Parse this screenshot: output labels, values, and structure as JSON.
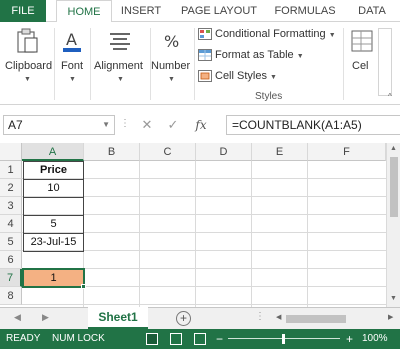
{
  "ribbon_tabs": [
    "FILE",
    "HOME",
    "INSERT",
    "PAGE LAYOUT",
    "FORMULAS",
    "DATA"
  ],
  "groups": {
    "clipboard": "Clipboard",
    "font": "Font",
    "alignment": "Alignment",
    "number": "Number",
    "conditional_formatting": "Conditional Formatting",
    "format_as_table": "Format as Table",
    "cell_styles": "Cell Styles",
    "styles_title": "Styles",
    "cells_partial": "Cel"
  },
  "formula_bar": {
    "name_box": "A7",
    "fx": "fx",
    "formula": "=COUNTBLANK(A1:A5)"
  },
  "columns": [
    "A",
    "B",
    "C",
    "D",
    "E",
    "F"
  ],
  "rows": [
    "1",
    "2",
    "3",
    "4",
    "5",
    "6",
    "7",
    "8"
  ],
  "cells": {
    "A1": "Price",
    "A2": "10",
    "A3": "",
    "A4": "5",
    "A5": "23-Jul-15",
    "A7": "1"
  },
  "sheets": [
    "Sheet1"
  ],
  "add_sheet": "+",
  "status": {
    "ready": "READY",
    "num_lock": "NUM LOCK",
    "zoom": "100%"
  },
  "colors": {
    "accent": "#217346",
    "selected_cell_fill": "#f4b183"
  }
}
